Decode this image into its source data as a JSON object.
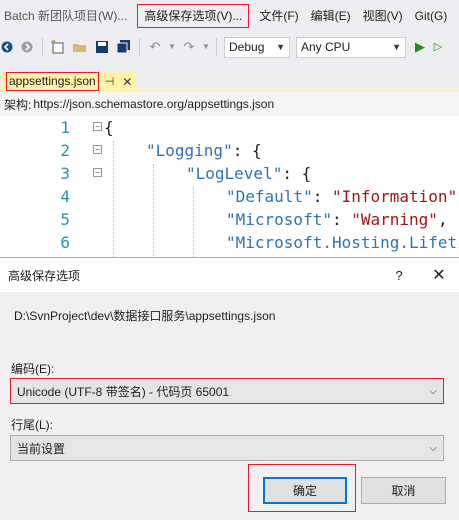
{
  "menubar": {
    "title": "Batch 新团队项目(W)...",
    "items": [
      "高级保存选项(V)...",
      "文件(F)",
      "编辑(E)",
      "视图(V)",
      "Git(G)"
    ]
  },
  "toolbar": {
    "config": "Debug",
    "platform": "Any CPU"
  },
  "tab": {
    "label": "appsettings.json",
    "pin": "⊣",
    "close": "✕"
  },
  "schema": {
    "label": "架构:",
    "url": "https://json.schemastore.org/appsettings.json"
  },
  "editor": {
    "lines": [
      {
        "n": "1",
        "text": "{"
      },
      {
        "n": "2",
        "key": "\"Logging\"",
        "rest": ": {"
      },
      {
        "n": "3",
        "key": "\"LogLevel\"",
        "rest": ": {"
      },
      {
        "n": "4",
        "key": "\"Default\"",
        "sep": ": ",
        "val": "\"Information\""
      },
      {
        "n": "5",
        "key": "\"Microsoft\"",
        "sep": ": ",
        "val": "\"Warning\"",
        "tail": ","
      },
      {
        "n": "6",
        "key": "\"Microsoft.Hosting.Lifetime\""
      }
    ]
  },
  "dialog": {
    "title": "高级保存选项",
    "help": "?",
    "close": "✕",
    "path": "D:\\SvnProject\\dev\\数据接口服务\\appsettings.json",
    "encoding_label": "编码(E):",
    "encoding_value": "Unicode (UTF-8 带签名) - 代码页 65001",
    "lineending_label": "行尾(L):",
    "lineending_value": "当前设置",
    "ok_label": "确定",
    "cancel_label": "取消"
  }
}
